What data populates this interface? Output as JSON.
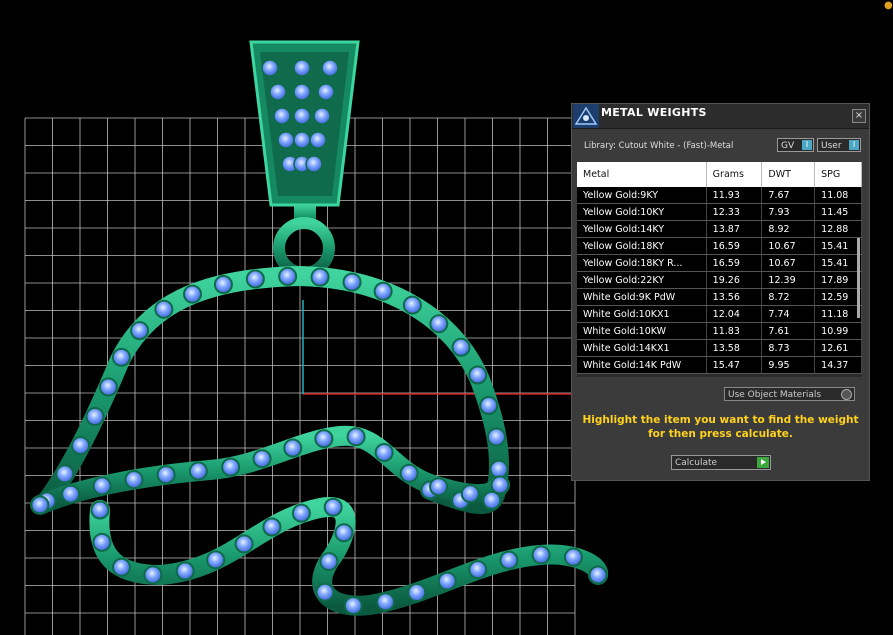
{
  "colors": {
    "background": "#000000",
    "grid": "#bfbfbf",
    "metal": "#1f9c72",
    "stone": "#6e9bff",
    "hint": "#ffd21e",
    "axis_x": "#d02020",
    "axis_y": "#20b0c0"
  },
  "panel": {
    "title": "METAL WEIGHTS",
    "close_label": "×",
    "library_label": "Library: Cutout White - (Fast)-Metal",
    "gv_label": "GV",
    "user_label": "User",
    "toggle_knob": "I",
    "table": {
      "headers": [
        "Metal",
        "Grams",
        "DWT",
        "SPG"
      ],
      "rows": [
        [
          "Yellow Gold:9KY",
          "11.93",
          "7.67",
          "11.08"
        ],
        [
          "Yellow Gold:10KY",
          "12.33",
          "7.93",
          "11.45"
        ],
        [
          "Yellow Gold:14KY",
          "13.87",
          "8.92",
          "12.88"
        ],
        [
          "Yellow Gold:18KY",
          "16.59",
          "10.67",
          "15.41"
        ],
        [
          "Yellow Gold:18KY R...",
          "16.59",
          "10.67",
          "15.41"
        ],
        [
          "Yellow Gold:22KY",
          "19.26",
          "12.39",
          "17.89"
        ],
        [
          "White Gold:9K PdW",
          "13.56",
          "8.72",
          "12.59"
        ],
        [
          "White Gold:10KX1",
          "12.04",
          "7.74",
          "11.18"
        ],
        [
          "White Gold:10KW",
          "11.83",
          "7.61",
          "10.99"
        ],
        [
          "White Gold:14KX1",
          "13.58",
          "8.73",
          "12.61"
        ],
        [
          "White Gold:14K PdW",
          "15.47",
          "9.95",
          "14.37"
        ]
      ]
    },
    "use_object_materials": "Use Object Materials",
    "hint_line1": "Highlight the item you want to find the weight",
    "hint_line2": "for then press calculate.",
    "calculate_label": "Calculate"
  }
}
